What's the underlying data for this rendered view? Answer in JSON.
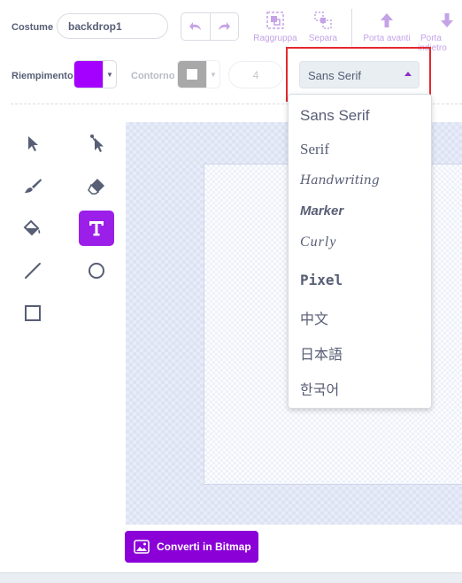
{
  "costume": {
    "label": "Costume",
    "name": "backdrop1"
  },
  "toolbar": {
    "group_label": "Raggruppa",
    "ungroup_label": "Separa",
    "forward_label": "Porta avanti",
    "backward_label": "Porta indietro"
  },
  "fill": {
    "label": "Riempimento",
    "color": "#a300ff"
  },
  "outline": {
    "label": "Contorno",
    "color": "#a8a8a8",
    "width": "4"
  },
  "font": {
    "selected": "Sans Serif",
    "options": [
      "Sans Serif",
      "Serif",
      "Handwriting",
      "Marker",
      "Curly",
      "Pixel",
      "中文",
      "日本語",
      "한국어"
    ]
  },
  "tools": [
    "select-tool",
    "reshape-tool",
    "brush-tool",
    "eraser-tool",
    "fill-tool",
    "text-tool",
    "line-tool",
    "circle-tool",
    "rectangle-tool"
  ],
  "active_tool": "text-tool",
  "convert": {
    "label": "Converti in Bitmap"
  },
  "colors": {
    "accent": "#8a00d6",
    "highlight": "#e5282f",
    "canvas": "#e8ecf9"
  }
}
